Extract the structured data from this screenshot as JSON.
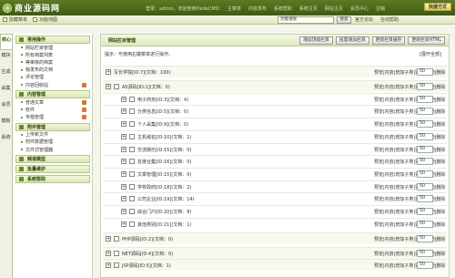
{
  "brand": {
    "logo_text": "商业源码网"
  },
  "topnav": {
    "login_info": "登录：admin，欢迎使用DedeCMS!",
    "items": [
      "主菜单",
      "内容发布",
      "系统帮助",
      "系统主页",
      "网站主页",
      "会员中心",
      "注销"
    ],
    "quick_btn": "快捷方式"
  },
  "subbar": {
    "hide_menu": "隐藏菜单",
    "func_map": "功能地图",
    "search_placeholder": "功能搜索",
    "search_btn": "搜索",
    "links": [
      "官方论坛",
      "在线帮助"
    ]
  },
  "vtabs": [
    "核心",
    "模块",
    "生成",
    "采集",
    "会员",
    "模板",
    "系统"
  ],
  "sidebar": [
    {
      "title": "常用操作",
      "items": [
        {
          "label": "网站栏目管理"
        },
        {
          "label": "所有档案列表"
        },
        {
          "label": "等审核的档案"
        },
        {
          "label": "我发布的文档"
        },
        {
          "label": "评论管理"
        },
        {
          "label": "内容回收站",
          "badge": true
        }
      ]
    },
    {
      "title": "内容管理",
      "items": [
        {
          "label": "普通文章",
          "badge": true
        },
        {
          "label": "软件",
          "badge": true
        },
        {
          "label": "专题管理",
          "badge": true
        }
      ]
    },
    {
      "title": "附件管理",
      "items": [
        {
          "label": "上传新文件"
        },
        {
          "label": "附件数据管理"
        },
        {
          "label": "文件式管理器"
        }
      ]
    },
    {
      "title": "频道模型",
      "items": []
    },
    {
      "title": "批量维护",
      "items": []
    },
    {
      "title": "系统帮助",
      "items": []
    }
  ],
  "main": {
    "title": "网站栏目管理",
    "buttons": [
      "增加顶级栏目",
      "批量增加栏目",
      "更新栏目缓存",
      "更新栏目HTML"
    ],
    "tip": "提示：可使用右键菜单进行操作。",
    "expand": "[展开全部]",
    "ops_label": "预览|内容|增加子类|更改|移动|删除",
    "rows": [
      {
        "level": 0,
        "name": "写长学院[ID:7](文档：100)",
        "order": "50"
      },
      {
        "level": 0,
        "name": "A5源码[ID:1](文档：0)",
        "order": "50",
        "checkbox": true
      },
      {
        "level": 1,
        "name": "电子商务[ID:3](文档：4)",
        "order": "50"
      },
      {
        "level": 1,
        "name": "分类信息[ID:5](文档：0)",
        "order": "50"
      },
      {
        "level": 1,
        "name": "个人采集[ID:9](文档：0)",
        "order": "50"
      },
      {
        "level": 1,
        "name": "主机域名[ID:10](文档：1)",
        "order": "50"
      },
      {
        "level": 1,
        "name": "交流娱乐[ID:15](文档：0)",
        "order": "50"
      },
      {
        "level": 1,
        "name": "友链合集[ID:16](文档：0)",
        "order": "50"
      },
      {
        "level": 1,
        "name": "文章管理[ID:15](文档：0)",
        "order": "50"
      },
      {
        "level": 1,
        "name": "学校政府[ID:18](文档：2)",
        "order": "50"
      },
      {
        "level": 1,
        "name": "公司企业[ID:19](文档：14)",
        "order": "50"
      },
      {
        "level": 1,
        "name": "综合门户[ID:20](文档：8)",
        "order": "50"
      },
      {
        "level": 1,
        "name": "其他类别[ID:21](文档：1)",
        "order": "50"
      },
      {
        "level": 0,
        "name": "PHP源码[ID:2](文档：0)",
        "order": "50",
        "checkbox": true
      },
      {
        "level": 0,
        "name": "NET源码[ID:4](文档：0)",
        "order": "50",
        "checkbox": true
      },
      {
        "level": 0,
        "name": "JSP源码[ID:5](文档：1)",
        "order": "50",
        "checkbox": true
      }
    ]
  }
}
